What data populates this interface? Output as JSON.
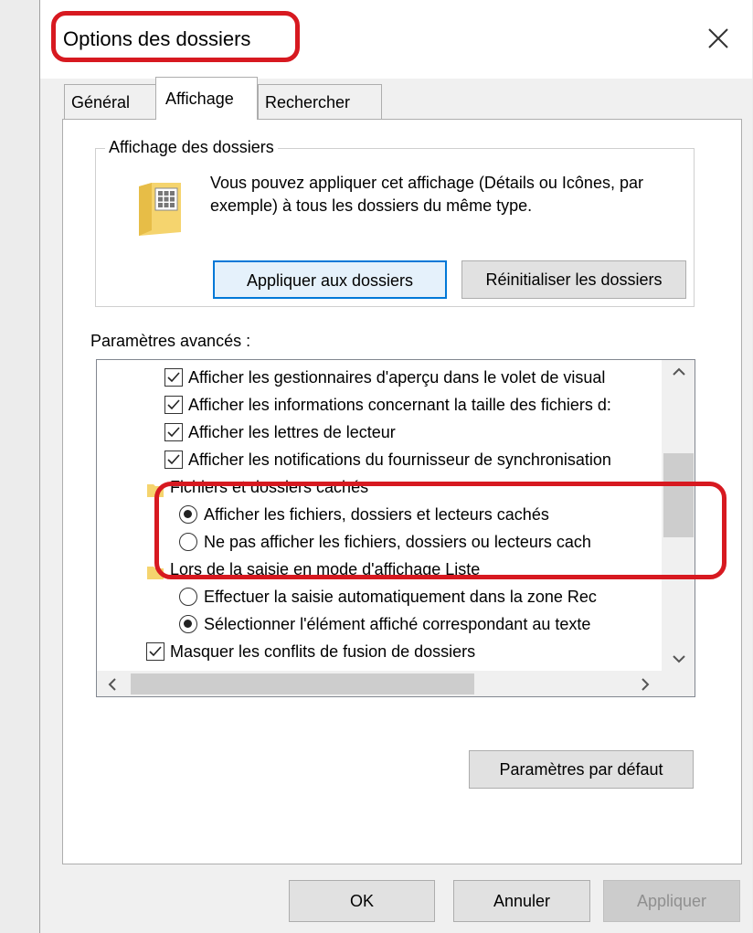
{
  "window": {
    "title": "Options des dossiers"
  },
  "tabs": [
    {
      "label": "Général",
      "selected": false
    },
    {
      "label": "Affichage",
      "selected": true
    },
    {
      "label": "Rechercher",
      "selected": false
    }
  ],
  "folder_view": {
    "group_label": "Affichage des dossiers",
    "description": "Vous pouvez appliquer cet affichage (Détails ou Icônes, par exemple) à tous les dossiers du même type.",
    "apply_button": "Appliquer aux dossiers",
    "reset_button": "Réinitialiser les dossiers"
  },
  "advanced": {
    "label": "Paramètres avancés :",
    "items": [
      {
        "type": "checkbox",
        "checked": true,
        "label": "Afficher les gestionnaires d'aperçu dans le volet de visual"
      },
      {
        "type": "checkbox",
        "checked": true,
        "label": "Afficher les informations concernant la taille des fichiers d:"
      },
      {
        "type": "checkbox",
        "checked": true,
        "label": "Afficher les lettres de lecteur"
      },
      {
        "type": "checkbox",
        "checked": true,
        "label": "Afficher les notifications du fournisseur de synchronisation"
      },
      {
        "type": "folder",
        "label": "Fichiers et dossiers cachés"
      },
      {
        "type": "radio",
        "checked": true,
        "label": "Afficher les fichiers, dossiers et lecteurs cachés"
      },
      {
        "type": "radio",
        "checked": false,
        "label": "Ne pas afficher les fichiers, dossiers ou lecteurs cach"
      },
      {
        "type": "folder",
        "label": "Lors de la saisie en mode d'affichage Liste"
      },
      {
        "type": "radio",
        "checked": false,
        "label": "Effectuer la saisie automatiquement dans la zone Rec"
      },
      {
        "type": "radio",
        "checked": true,
        "label": "Sélectionner l'élément affiché correspondant au texte"
      },
      {
        "type": "checkbox",
        "checked": true,
        "label": "Masquer les conflits de fusion de dossiers"
      }
    ],
    "defaults_button": "Paramètres par défaut"
  },
  "footer": {
    "ok": "OK",
    "cancel": "Annuler",
    "apply": "Appliquer"
  },
  "colors": {
    "highlight": "#d71920",
    "folder": "#f5d46e",
    "focus": "#0078d7"
  },
  "icons": [
    "close-icon",
    "folder-view-icon",
    "checkbox-checked-icon",
    "radio-icon",
    "folder-icon",
    "scroll-up-icon",
    "scroll-down-icon",
    "scroll-left-icon",
    "scroll-right-icon"
  ]
}
